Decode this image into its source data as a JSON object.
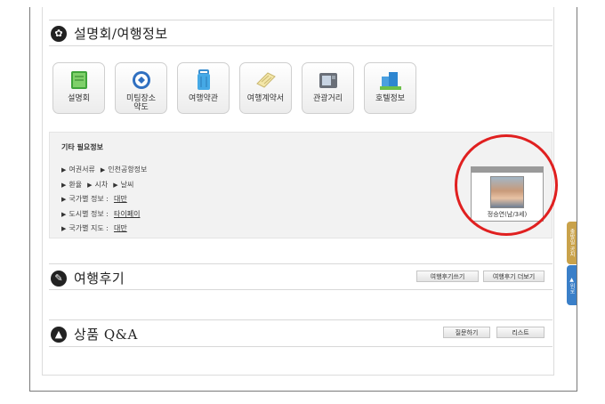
{
  "info_section": {
    "title": "설명회/여행정보",
    "tiles": [
      {
        "label": "설명회",
        "icon": "book-icon"
      },
      {
        "label": "미팅장소\n약도",
        "icon": "map-icon"
      },
      {
        "label": "여행약관",
        "icon": "luggage-icon"
      },
      {
        "label": "여행계약서",
        "icon": "document-icon"
      },
      {
        "label": "관광거리",
        "icon": "camera-icon"
      },
      {
        "label": "호텔정보",
        "icon": "hotel-icon"
      }
    ]
  },
  "extra_info": {
    "title": "기타 필요정보",
    "row1": {
      "a": "여권서류",
      "b": "인천공항정보"
    },
    "row2": {
      "a": "환율",
      "b": "시차",
      "c": "날씨"
    },
    "row3": {
      "label": "국가별 정보 :",
      "link": "대만"
    },
    "row4": {
      "label": "도시별 정보 :",
      "link": "타이페이"
    },
    "row5": {
      "label": "국가별 지도 :",
      "link": "대만"
    }
  },
  "profile": {
    "caption": "정승연(남/3세)"
  },
  "review_section": {
    "title": "여행후기",
    "write_label": "여행후기쓰기",
    "more_label": "여행후기 더보기"
  },
  "qa_section": {
    "title": "상품 Q&A",
    "ask_label": "질문하기",
    "list_label": "리스트"
  },
  "side_tabs": {
    "top_label": "출발일 공지",
    "bottom_label": "위로"
  },
  "colors": {
    "highlight_circle": "#e02020",
    "side_tab_top": "#c9a24a",
    "side_tab_bottom": "#3a7fc8"
  }
}
